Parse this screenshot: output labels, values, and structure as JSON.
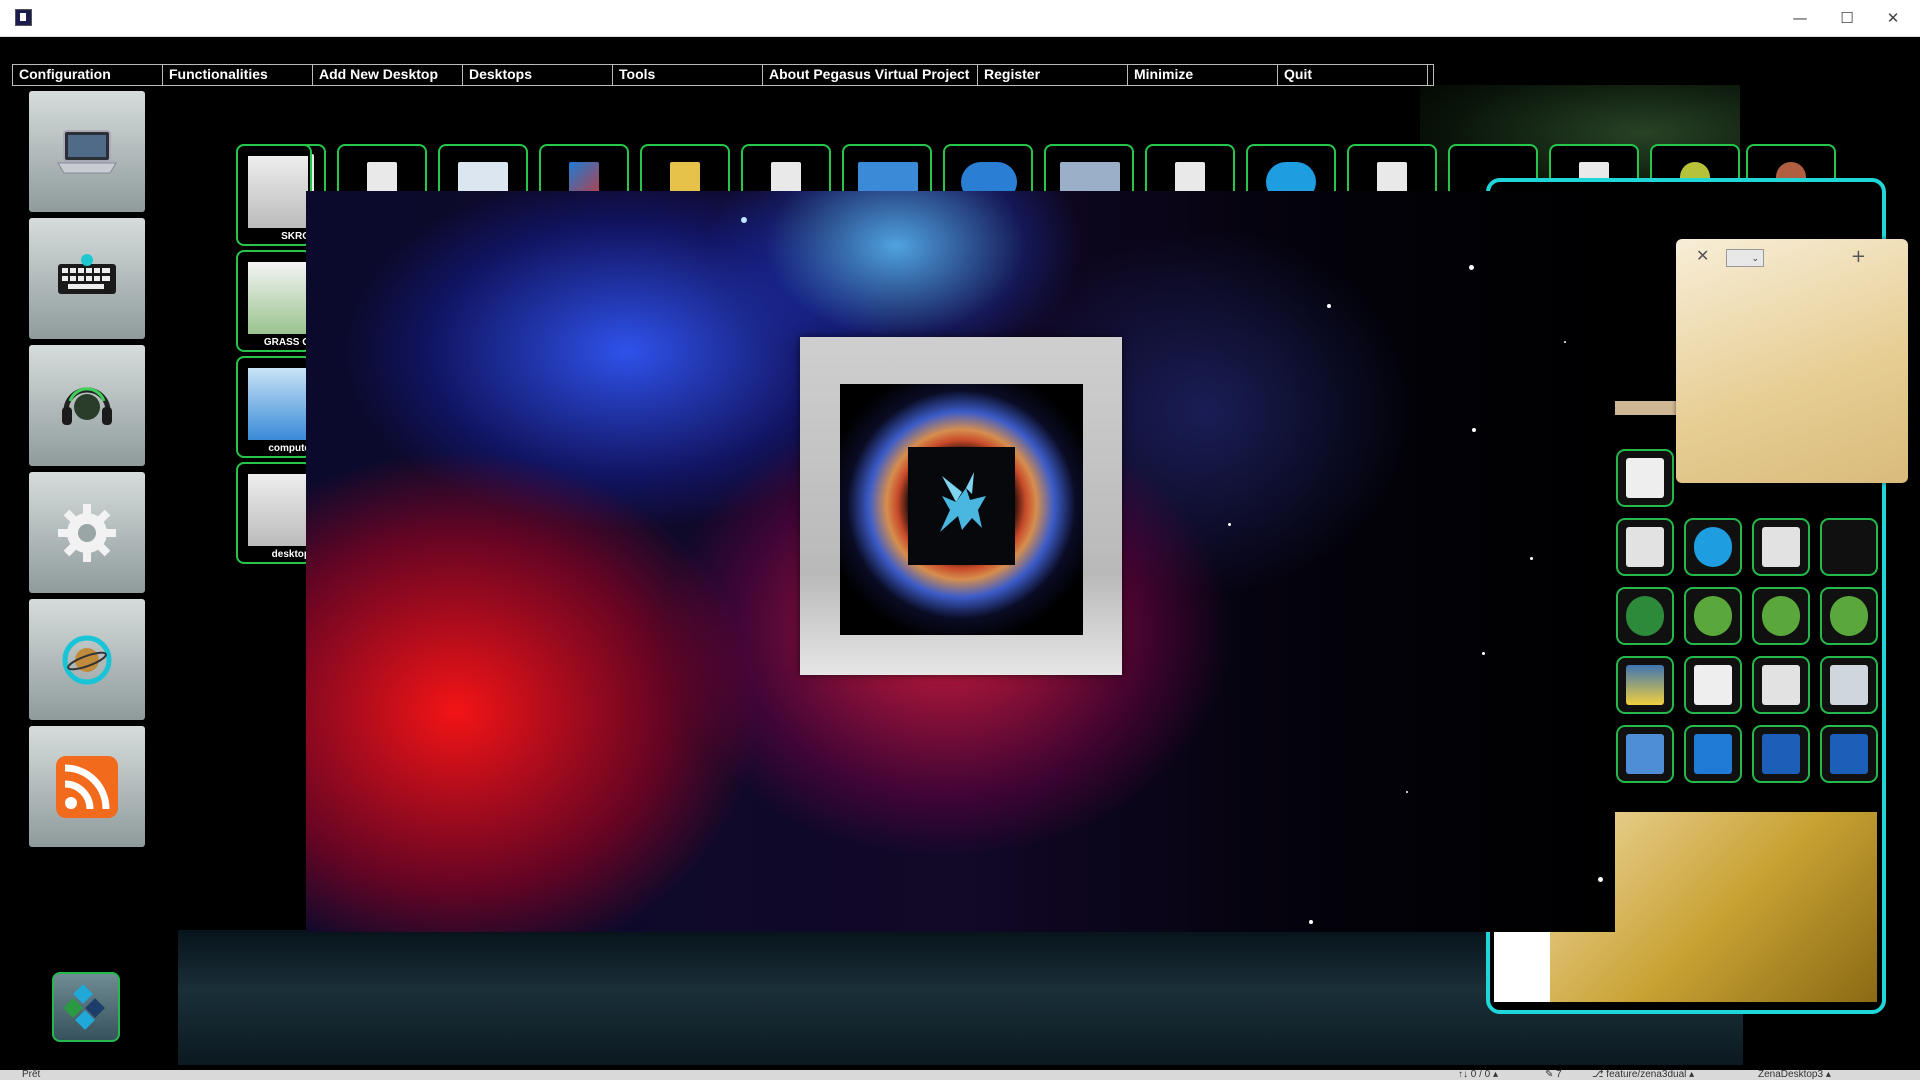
{
  "window": {
    "minimize_glyph": "—",
    "maximize_glyph": "☐",
    "close_glyph": "✕"
  },
  "menu": {
    "items": [
      "Configuration",
      "Functionalities",
      "Add New Desktop",
      "Desktops",
      "Tools",
      "About Pegasus Virtual Project",
      "Register",
      "Minimize",
      "Quit"
    ]
  },
  "launcher": {
    "items": [
      {
        "icon": "laptop-icon"
      },
      {
        "icon": "keyboard-icon"
      },
      {
        "icon": "headphones-icon"
      },
      {
        "icon": "gear-icon"
      },
      {
        "icon": "planet-icon"
      },
      {
        "icon": "rss-icon"
      }
    ]
  },
  "desktop_shortcuts": {
    "left_labels": [
      "SKRO",
      "GRASS G",
      "compute",
      "desktop"
    ]
  },
  "sticky_note": {
    "close_glyph": "✕",
    "add_glyph": "+",
    "dropdown_value": "⌄"
  },
  "statusbar": {
    "left_text": "Prêt",
    "sync_text": "↑↓ 0 / 0 ▴",
    "edit_text": "✎ 7",
    "branch_text": "⎇ feature/zena3dual ▴",
    "project_text": "ZenaDesktop3 ▴"
  },
  "colors": {
    "accent_green": "#27c64a",
    "frame_cyan": "#1fd6d8",
    "note_bg": "#f1e1b9"
  }
}
